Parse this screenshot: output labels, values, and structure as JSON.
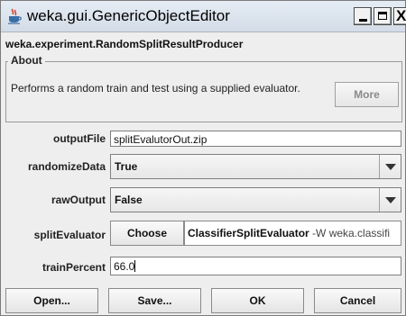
{
  "window": {
    "title": "weka.gui.GenericObjectEditor",
    "close_glyph": "X"
  },
  "editor": {
    "class_name": "weka.experiment.RandomSplitResultProducer",
    "about": {
      "legend": "About",
      "description": "Performs a random train and test using a supplied evaluator.",
      "more_label": "More"
    }
  },
  "properties": {
    "output_file": {
      "label": "outputFile",
      "value": "splitEvalutorOut.zip"
    },
    "randomize_data": {
      "label": "randomizeData",
      "value": "True"
    },
    "raw_output": {
      "label": "rawOutput",
      "value": "False"
    },
    "split_evaluator": {
      "label": "splitEvaluator",
      "choose_label": "Choose",
      "class_name": "ClassifierSplitEvaluator",
      "options": " -W weka.classifi"
    },
    "train_percent": {
      "label": "trainPercent",
      "value": "66.0"
    }
  },
  "buttons": {
    "open": "Open...",
    "save": "Save...",
    "ok": "OK",
    "cancel": "Cancel"
  },
  "icons": {
    "app": "java-cup-icon",
    "minimize": "minimize-icon",
    "maximize": "maximize-icon",
    "close": "close-icon",
    "dropdown": "chevron-down-icon"
  }
}
